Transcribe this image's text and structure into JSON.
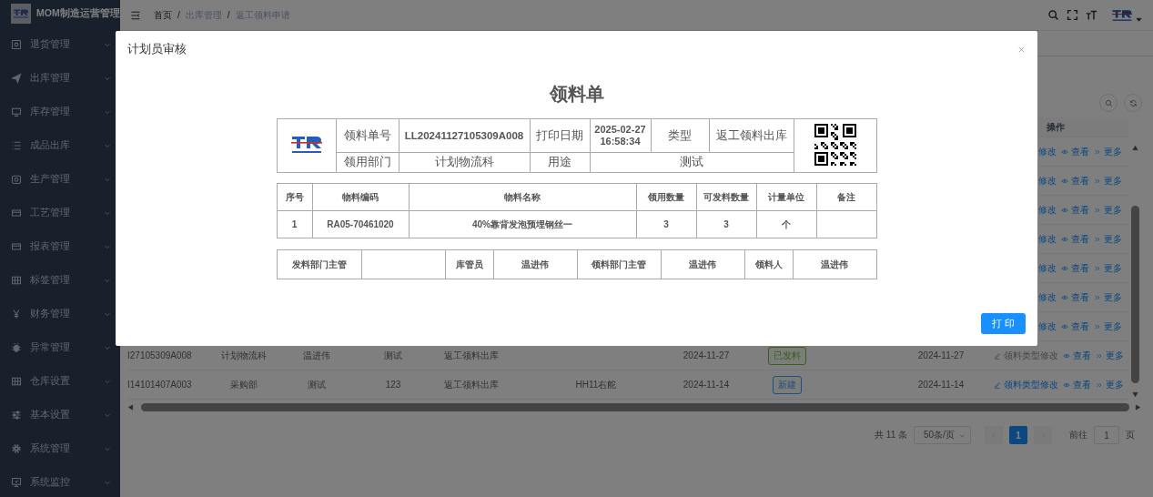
{
  "sidebar": {
    "title": "MOM制造运营管理",
    "items": [
      "退货管理",
      "出库管理",
      "库存管理",
      "成品出库",
      "生产管理",
      "工艺管理",
      "报表管理",
      "标签管理",
      "财务管理",
      "异常管理",
      "仓库设置",
      "基本设置",
      "系统管理",
      "系统监控"
    ]
  },
  "topbar": {
    "breadcrumb": [
      "首页",
      "出库管理",
      "返工领料申请"
    ],
    "separator": "/"
  },
  "table": {
    "action_header": "操作",
    "covered_rows": [
      {
        "actions": [
          {
            "label": "修改",
            "disabled": false
          },
          {
            "label": "查看",
            "disabled": false
          },
          {
            "label": "更多",
            "disabled": false
          }
        ]
      },
      {
        "actions": [
          {
            "label": "修改",
            "disabled": false
          },
          {
            "label": "查看",
            "disabled": false
          },
          {
            "label": "更多",
            "disabled": false
          }
        ]
      },
      {
        "actions": [
          {
            "label": "修改",
            "disabled": false
          },
          {
            "label": "查看",
            "disabled": false
          },
          {
            "label": "更多",
            "disabled": false
          }
        ]
      },
      {
        "actions": [
          {
            "label": "修改",
            "disabled": false
          },
          {
            "label": "查看",
            "disabled": false
          },
          {
            "label": "更多",
            "disabled": false
          }
        ]
      },
      {
        "actions": [
          {
            "label": "修改",
            "disabled": false
          },
          {
            "label": "查看",
            "disabled": false
          },
          {
            "label": "更多",
            "disabled": false
          }
        ]
      },
      {
        "actions": [
          {
            "label": "修改",
            "disabled": false
          },
          {
            "label": "查看",
            "disabled": false
          },
          {
            "label": "更多",
            "disabled": false
          }
        ]
      },
      {
        "actions": [
          {
            "label": "修改",
            "disabled": false
          },
          {
            "label": "查看",
            "disabled": false
          },
          {
            "label": "更多",
            "disabled": false
          }
        ]
      }
    ],
    "rows": [
      {
        "column_1": "I27105309A008",
        "column_2": "计划物流科",
        "column_3": "温进伟",
        "column_4": "测试",
        "column_5": "返工领料出库",
        "column_7": "2024-11-27",
        "status": {
          "label": "已发料",
          "color": "#34611d"
        },
        "column_10": "2024-11-27",
        "actions": [
          {
            "label": "领料类型修改",
            "disabled": true
          },
          {
            "label": "查看",
            "disabled": false
          },
          {
            "label": "更多",
            "disabled": false
          }
        ]
      },
      {
        "column_1": "I14101407A003",
        "column_2": "采购部",
        "column_3": "测试",
        "column_4": "123",
        "column_5": "返工领料出库",
        "column_6": "HH11右舵",
        "column_7": "2024-11-14",
        "status": {
          "label": "新建",
          "color": "#204f80"
        },
        "column_10": "2024-11-14",
        "actions": [
          {
            "label": "领料类型修改",
            "disabled": false
          },
          {
            "label": "查看",
            "disabled": false
          },
          {
            "label": "更多",
            "disabled": false
          }
        ]
      }
    ]
  },
  "pagination": {
    "total": "共 11 条",
    "page_size": "50条/页",
    "pages": [
      {
        "label": "1",
        "selected": true
      }
    ],
    "jump_label": "前往",
    "jump_value": "1",
    "jump_unit": "页"
  },
  "dialog": {
    "title": "计划员审核",
    "document_title": "领料单",
    "header": {
      "order_no_label": "领料单号",
      "order_no": "LL20241127105309A008",
      "print_date_label": "打印日期",
      "print_date": "2025-02-27 16:58:34",
      "type_label": "类型",
      "type": "返工领料出库",
      "department_label": "领用部门",
      "department": "计划物流科",
      "purpose_label": "用途",
      "purpose": "测试"
    },
    "items": {
      "columns": [
        "序号",
        "物料编码",
        "物料名称",
        "领用数量",
        "可发料数量",
        "计量单位",
        "备注"
      ],
      "rows": [
        [
          "1",
          "RA05-70461020",
          "40%靠背发泡预埋钢丝一",
          "3",
          "3",
          "个"
        ]
      ]
    },
    "signatures": [
      {
        "label": "发料部门主管"
      },
      {
        "label": "库管员",
        "name": "温进伟"
      },
      {
        "label": "领料部门主管",
        "name": "温进伟"
      },
      {
        "label": "领料人",
        "name": "温进伟"
      }
    ],
    "print_button": "打 印"
  }
}
